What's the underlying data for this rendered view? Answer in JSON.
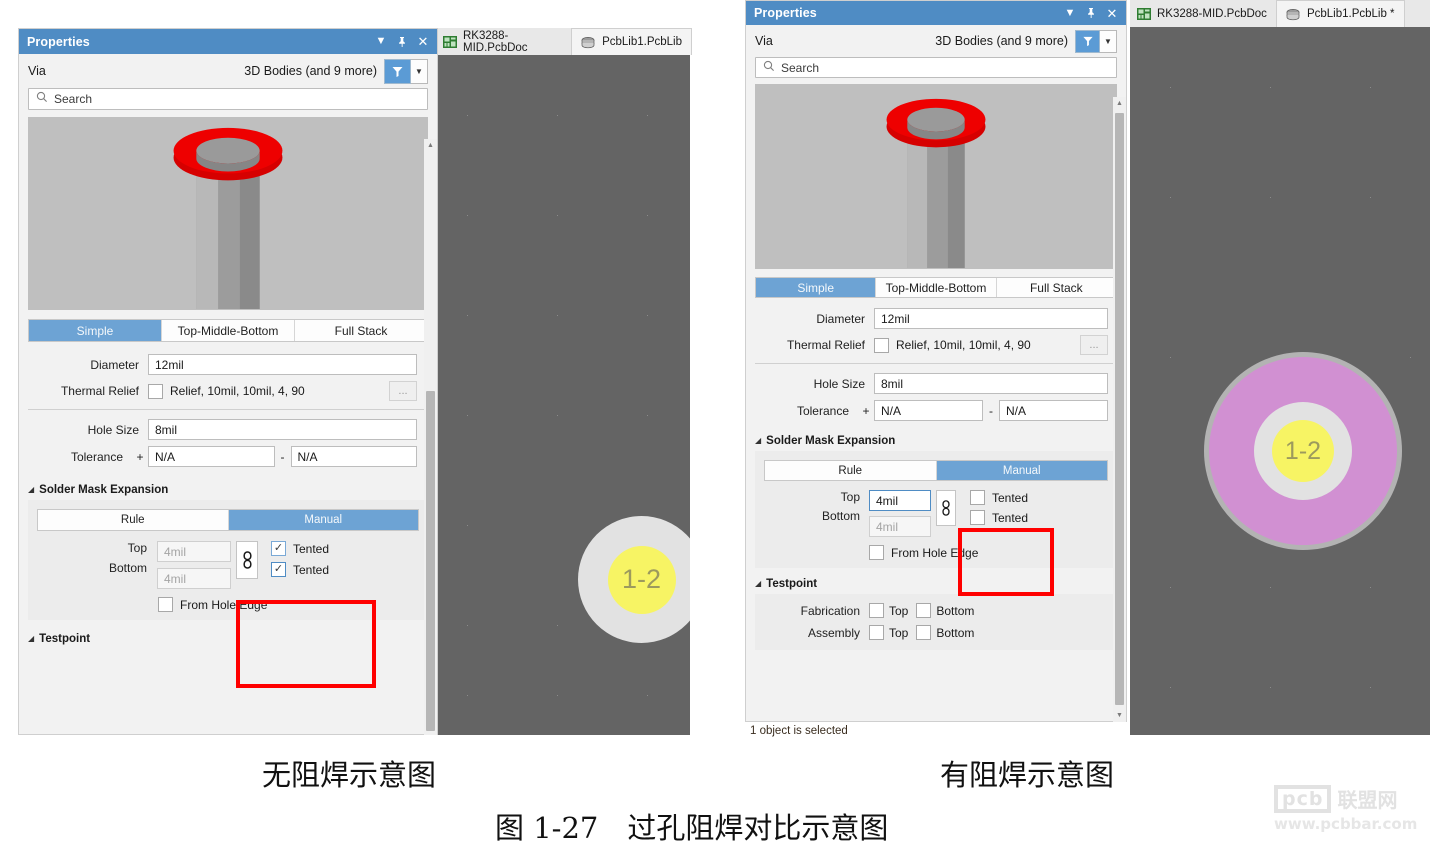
{
  "left_panel": {
    "title": "Properties",
    "object_type": "Via",
    "filter_label": "3D Bodies (and 9 more)",
    "search_placeholder": "Search",
    "icons": {
      "collapse": "chevron-down-icon",
      "pin": "pin-icon",
      "close": "close-icon",
      "filter": "funnel-icon",
      "filter_dropdown": "chevron-down-icon",
      "search": "search-icon"
    },
    "stack_tabs": [
      {
        "label": "Simple",
        "active": true
      },
      {
        "label": "Top-Middle-Bottom",
        "active": false
      },
      {
        "label": "Full Stack",
        "active": false
      }
    ],
    "fields": {
      "diameter_label": "Diameter",
      "diameter_value": "12mil",
      "thermal_relief_label": "Thermal Relief",
      "thermal_relief_value": "Relief, 10mil, 10mil, 4, 90",
      "thermal_relief_checked": false,
      "thermal_more": "...",
      "hole_size_label": "Hole Size",
      "hole_size_value": "8mil",
      "tolerance_label": "Tolerance",
      "tolerance_plus_sign": "+",
      "tolerance_plus_value": "N/A",
      "tolerance_minus_sign": "-",
      "tolerance_minus_value": "N/A"
    },
    "solder_mask": {
      "section_title": "Solder Mask Expansion",
      "mode_tabs": [
        {
          "label": "Rule",
          "active": false
        },
        {
          "label": "Manual",
          "active": true
        }
      ],
      "top_label": "Top",
      "top_value": "4mil",
      "top_disabled": true,
      "bottom_label": "Bottom",
      "bottom_value": "4mil",
      "bottom_disabled": true,
      "top_tented_label": "Tented",
      "top_tented_checked": true,
      "bottom_tented_label": "Tented",
      "bottom_tented_checked": true,
      "from_hole_edge_label": "From Hole Edge",
      "from_hole_edge_checked": false,
      "link_icon": "chain-link-icon"
    },
    "testpoint": {
      "section_title": "Testpoint"
    }
  },
  "right_panel": {
    "title": "Properties",
    "object_type": "Via",
    "filter_label": "3D Bodies (and 9 more)",
    "search_placeholder": "Search",
    "stack_tabs": [
      {
        "label": "Simple",
        "active": true
      },
      {
        "label": "Top-Middle-Bottom",
        "active": false
      },
      {
        "label": "Full Stack",
        "active": false
      }
    ],
    "fields": {
      "diameter_label": "Diameter",
      "diameter_value": "12mil",
      "thermal_relief_label": "Thermal Relief",
      "thermal_relief_value": "Relief, 10mil, 10mil, 4, 90",
      "thermal_relief_checked": false,
      "thermal_more": "...",
      "hole_size_label": "Hole Size",
      "hole_size_value": "8mil",
      "tolerance_label": "Tolerance",
      "tolerance_plus_sign": "+",
      "tolerance_plus_value": "N/A",
      "tolerance_minus_sign": "-",
      "tolerance_minus_value": "N/A"
    },
    "solder_mask": {
      "section_title": "Solder Mask Expansion",
      "mode_tabs": [
        {
          "label": "Rule",
          "active": false
        },
        {
          "label": "Manual",
          "active": true
        }
      ],
      "top_label": "Top",
      "top_value": "4mil",
      "top_disabled": false,
      "bottom_label": "Bottom",
      "bottom_value": "4mil",
      "bottom_disabled": true,
      "top_tented_label": "Tented",
      "top_tented_checked": false,
      "bottom_tented_label": "Tented",
      "bottom_tented_checked": false,
      "from_hole_edge_label": "From Hole Edge",
      "from_hole_edge_checked": false,
      "link_icon": "chain-link-icon"
    },
    "testpoint": {
      "section_title": "Testpoint",
      "fabrication_label": "Fabrication",
      "fabrication_top_label": "Top",
      "fabrication_bottom_label": "Bottom",
      "assembly_label": "Assembly",
      "assembly_top_label": "Top",
      "assembly_bottom_label": "Bottom"
    },
    "status_text": "1 object is selected"
  },
  "left_doc_tabs": [
    {
      "label": "RK3288-MID.PcbDoc",
      "icon": "pcb-doc-icon",
      "active": false
    },
    {
      "label": "PcbLib1.PcbLib",
      "icon": "pcb-lib-icon",
      "active": true
    }
  ],
  "right_doc_tabs": [
    {
      "label": "RK3288-MID.PcbDoc",
      "icon": "pcb-doc-icon",
      "active": false
    },
    {
      "label": "PcbLib1.PcbLib *",
      "icon": "pcb-lib-icon",
      "active": true
    }
  ],
  "left_canvas": {
    "via_label": "1-2",
    "ring_color": "#e2e2e2",
    "pad_color": "#f7f464",
    "background": "#646464"
  },
  "right_canvas": {
    "via_label": "1-2",
    "mask_color": "#d190d2",
    "ring_color": "#e2e2e2",
    "pad_color": "#f7f464",
    "outline_color": "#b3b3b3",
    "background": "#646464"
  },
  "captions": {
    "left": "无阻焊示意图",
    "right": "有阻焊示意图",
    "figure": "图 1-27　过孔阻焊对比示意图"
  },
  "watermark": {
    "logo_text": "pcb",
    "cn_text": "联盟网",
    "url": "www.pcbbar.com"
  },
  "colors": {
    "accent": "#4f8cc4",
    "tab_active": "#6da3d4",
    "highlight_box": "#ff0000",
    "panel_bg": "#f2f2f2",
    "canvas_bg": "#646464"
  }
}
